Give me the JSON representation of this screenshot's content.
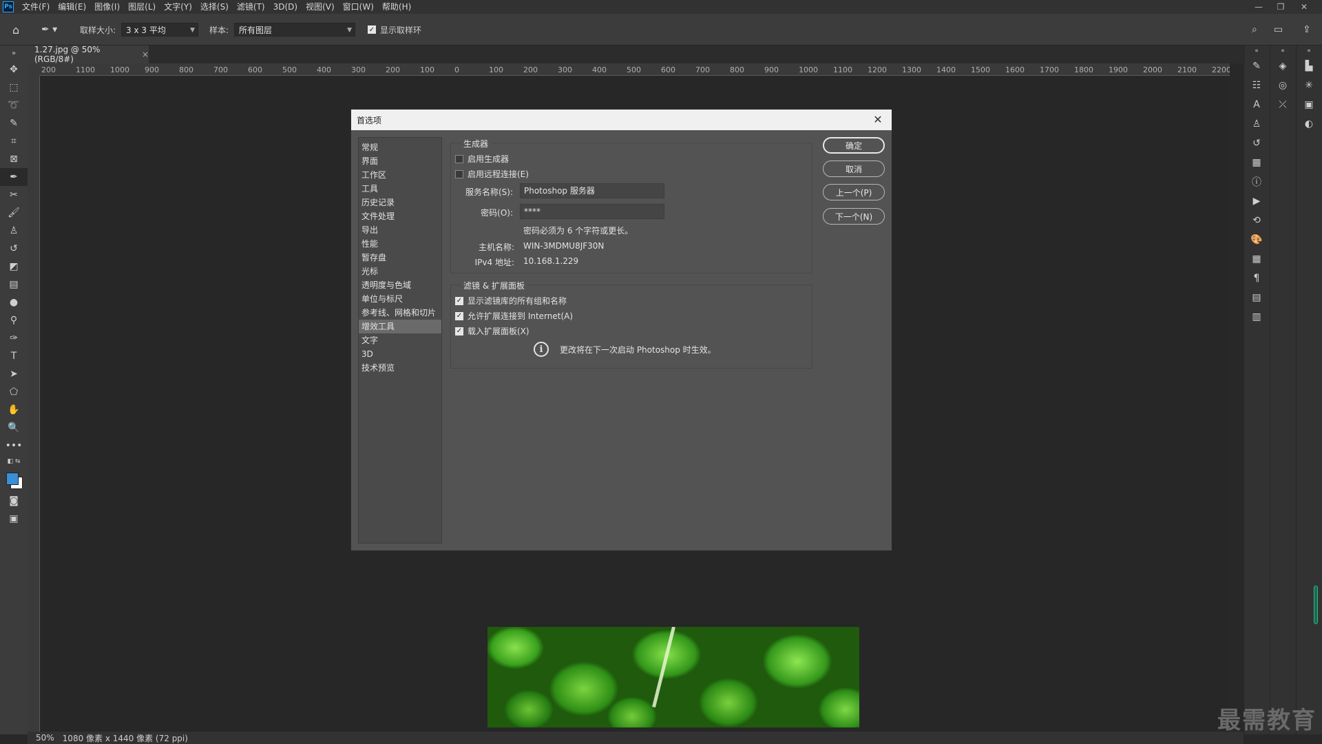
{
  "menubar": {
    "logo": "Ps",
    "items": [
      "文件(F)",
      "编辑(E)",
      "图像(I)",
      "图层(L)",
      "文字(Y)",
      "选择(S)",
      "滤镜(T)",
      "3D(D)",
      "视图(V)",
      "窗口(W)",
      "帮助(H)"
    ]
  },
  "options": {
    "sample_size_label": "取样大小:",
    "sample_size_value": "3 x 3 平均",
    "sample_label": "样本:",
    "sample_value": "所有图层",
    "show_ring_label": "显示取样环",
    "show_ring_checked": true
  },
  "document": {
    "tab_title": "1.27.jpg @ 50%(RGB/8#)",
    "close": "×",
    "ruler_labels": [
      "200",
      "1100",
      "1000",
      "900",
      "800",
      "700",
      "600",
      "500",
      "400",
      "300",
      "200",
      "100",
      "0",
      "100",
      "200",
      "300",
      "400",
      "500",
      "600",
      "700",
      "800",
      "900",
      "1000",
      "1100",
      "1200",
      "1300",
      "1400",
      "1500",
      "1600",
      "1700",
      "1800",
      "1900",
      "2000",
      "2100",
      "2200"
    ]
  },
  "status": {
    "zoom": "50%",
    "info": "1080 像素 x 1440 像素 (72 ppi)"
  },
  "dialog": {
    "title": "首选项",
    "nav": [
      "常规",
      "界面",
      "工作区",
      "工具",
      "历史记录",
      "文件处理",
      "导出",
      "性能",
      "暂存盘",
      "光标",
      "透明度与色域",
      "单位与标尺",
      "参考线、网格和切片",
      "增效工具",
      "文字",
      "3D",
      "技术预览"
    ],
    "selected_nav": "增效工具",
    "generator": {
      "legend": "生成器",
      "enable_generator": "启用生成器",
      "enable_generator_checked": false,
      "enable_remote": "启用远程连接(E)",
      "enable_remote_checked": false,
      "service_name_label": "服务名称(S):",
      "service_name_value": "Photoshop 服务器",
      "password_label": "密码(O):",
      "password_value": "****",
      "password_hint": "密码必须为 6 个字符或更长。",
      "host_label": "主机名称:",
      "host_value": "WIN-3MDMU8JF30N",
      "ipv4_label": "IPv4 地址:",
      "ipv4_value": "10.168.1.229"
    },
    "filters": {
      "legend": "滤镜 & 扩展面板",
      "show_all_groups": "显示滤镜库的所有组和名称",
      "show_all_groups_checked": true,
      "allow_internet": "允许扩展连接到 Internet(A)",
      "allow_internet_checked": true,
      "load_extensions": "载入扩展面板(X)",
      "load_extensions_checked": true,
      "notice": "更改将在下一次启动 Photoshop 时生效。"
    },
    "buttons": {
      "ok": "确定",
      "cancel": "取消",
      "prev": "上一个(P)",
      "next": "下一个(N)"
    }
  },
  "watermark": "最需教育",
  "icons": {
    "tools": [
      "move-icon",
      "marquee-icon",
      "lasso-icon",
      "quick-select-icon",
      "crop-icon",
      "frame-icon",
      "eyedropper-icon",
      "healing-icon",
      "brush-icon",
      "stamp-icon",
      "history-brush-icon",
      "eraser-icon",
      "gradient-icon",
      "blur-icon",
      "dodge-icon",
      "pen-icon",
      "type-icon",
      "path-select-icon",
      "shape-icon",
      "hand-icon",
      "zoom-icon",
      "more-icon"
    ]
  }
}
